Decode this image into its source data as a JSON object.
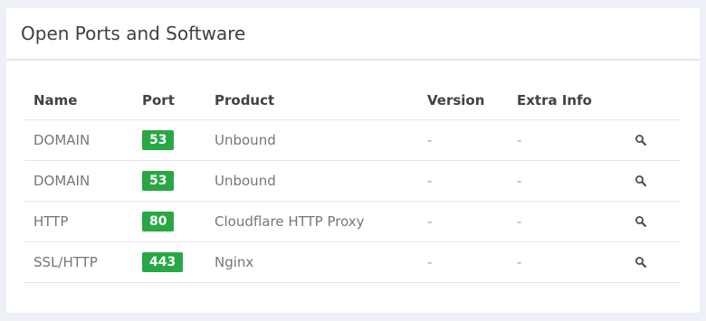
{
  "panel": {
    "title": "Open Ports and Software"
  },
  "table": {
    "headers": [
      "Name",
      "Port",
      "Product",
      "Version",
      "Extra Info",
      ""
    ],
    "rows": [
      {
        "name": "DOMAIN",
        "port": "53",
        "product": "Unbound",
        "version": "-",
        "extra": "-"
      },
      {
        "name": "DOMAIN",
        "port": "53",
        "product": "Unbound",
        "version": "-",
        "extra": "-"
      },
      {
        "name": "HTTP",
        "port": "80",
        "product": "Cloudflare HTTP Proxy",
        "version": "-",
        "extra": "-"
      },
      {
        "name": "SSL/HTTP",
        "port": "443",
        "product": "Nginx",
        "version": "-",
        "extra": "-"
      }
    ]
  },
  "colors": {
    "badge": "#28a745",
    "background": "#eef0f7"
  },
  "icons": {
    "row_action": "search-icon"
  }
}
